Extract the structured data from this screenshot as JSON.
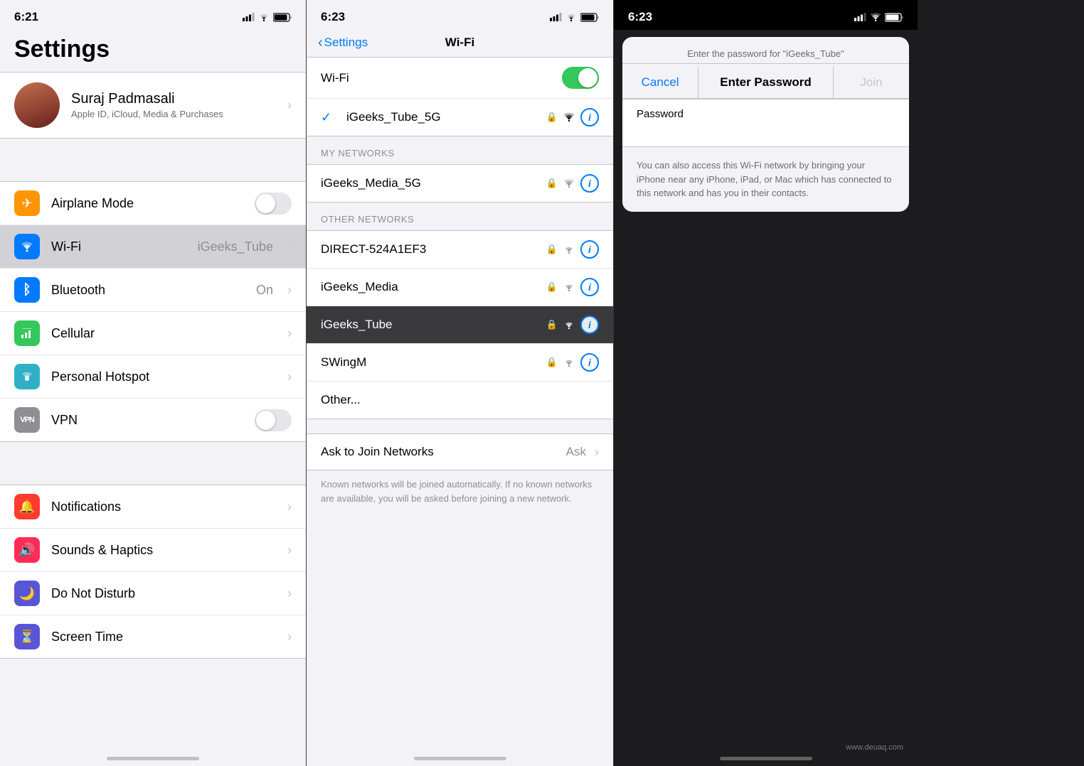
{
  "panel1": {
    "status_time": "6:21",
    "title": "Settings",
    "profile": {
      "name": "Suraj Padmasali",
      "subtitle": "Apple ID, iCloud, Media & Purchases"
    },
    "rows": [
      {
        "id": "airplane",
        "label": "Airplane Mode",
        "icon_color": "orange",
        "icon": "✈",
        "control": "toggle",
        "toggle_on": false
      },
      {
        "id": "wifi",
        "label": "Wi-Fi",
        "icon_color": "blue",
        "icon": "wifi",
        "value": "iGeeks_Tube",
        "control": "chevron",
        "highlighted": true
      },
      {
        "id": "bluetooth",
        "label": "Bluetooth",
        "icon_color": "blue-mid",
        "icon": "bt",
        "value": "On",
        "control": "chevron"
      },
      {
        "id": "cellular",
        "label": "Cellular",
        "icon_color": "green",
        "icon": "cell",
        "control": "chevron"
      },
      {
        "id": "hotspot",
        "label": "Personal Hotspot",
        "icon_color": "teal",
        "icon": "hotspot",
        "control": "chevron"
      },
      {
        "id": "vpn",
        "label": "VPN",
        "icon_color": "gray",
        "icon": "vpn",
        "control": "toggle",
        "toggle_on": false
      }
    ],
    "rows2": [
      {
        "id": "notifications",
        "label": "Notifications",
        "icon_color": "red",
        "icon": "🔔",
        "control": "chevron"
      },
      {
        "id": "sounds",
        "label": "Sounds & Haptics",
        "icon_color": "red-orange",
        "icon": "🔊",
        "control": "chevron"
      },
      {
        "id": "donotdisturb",
        "label": "Do Not Disturb",
        "icon_color": "indigo",
        "icon": "🌙",
        "control": "chevron"
      },
      {
        "id": "screentime",
        "label": "Screen Time",
        "icon_color": "yellow",
        "icon": "⏳",
        "control": "chevron"
      }
    ]
  },
  "panel2": {
    "status_time": "6:23",
    "nav_back": "Settings",
    "nav_title": "Wi-Fi",
    "wifi_toggle": true,
    "current_network": "iGeeks_Tube_5G",
    "my_networks_header": "MY NETWORKS",
    "my_networks": [
      {
        "id": "media5g",
        "label": "iGeeks_Media_5G",
        "secured": true
      }
    ],
    "other_networks_header": "OTHER NETWORKS",
    "other_networks": [
      {
        "id": "direct",
        "label": "DIRECT-524A1EF3",
        "secured": true
      },
      {
        "id": "media",
        "label": "iGeeks_Media",
        "secured": true
      },
      {
        "id": "tube",
        "label": "iGeeks_Tube",
        "secured": true,
        "highlighted": true
      },
      {
        "id": "swingm",
        "label": "SWingM",
        "secured": true
      },
      {
        "id": "other",
        "label": "Other...",
        "secured": false
      }
    ],
    "ask_label": "Ask to Join Networks",
    "ask_value": "Ask",
    "ask_note": "Known networks will be joined automatically. If no known networks are available, you will be asked before joining a new network."
  },
  "panel3": {
    "status_time": "6:23",
    "dialog": {
      "subtitle": "Enter the password for \"iGeeks_Tube\"",
      "cancel": "Cancel",
      "title": "Enter Password",
      "join": "Join",
      "password_label": "Password",
      "hint": "You can also access this Wi-Fi network by bringing your iPhone near any iPhone, iPad, or Mac which has connected to this network and has you in their contacts."
    }
  },
  "watermark": "www.deuaq.com"
}
